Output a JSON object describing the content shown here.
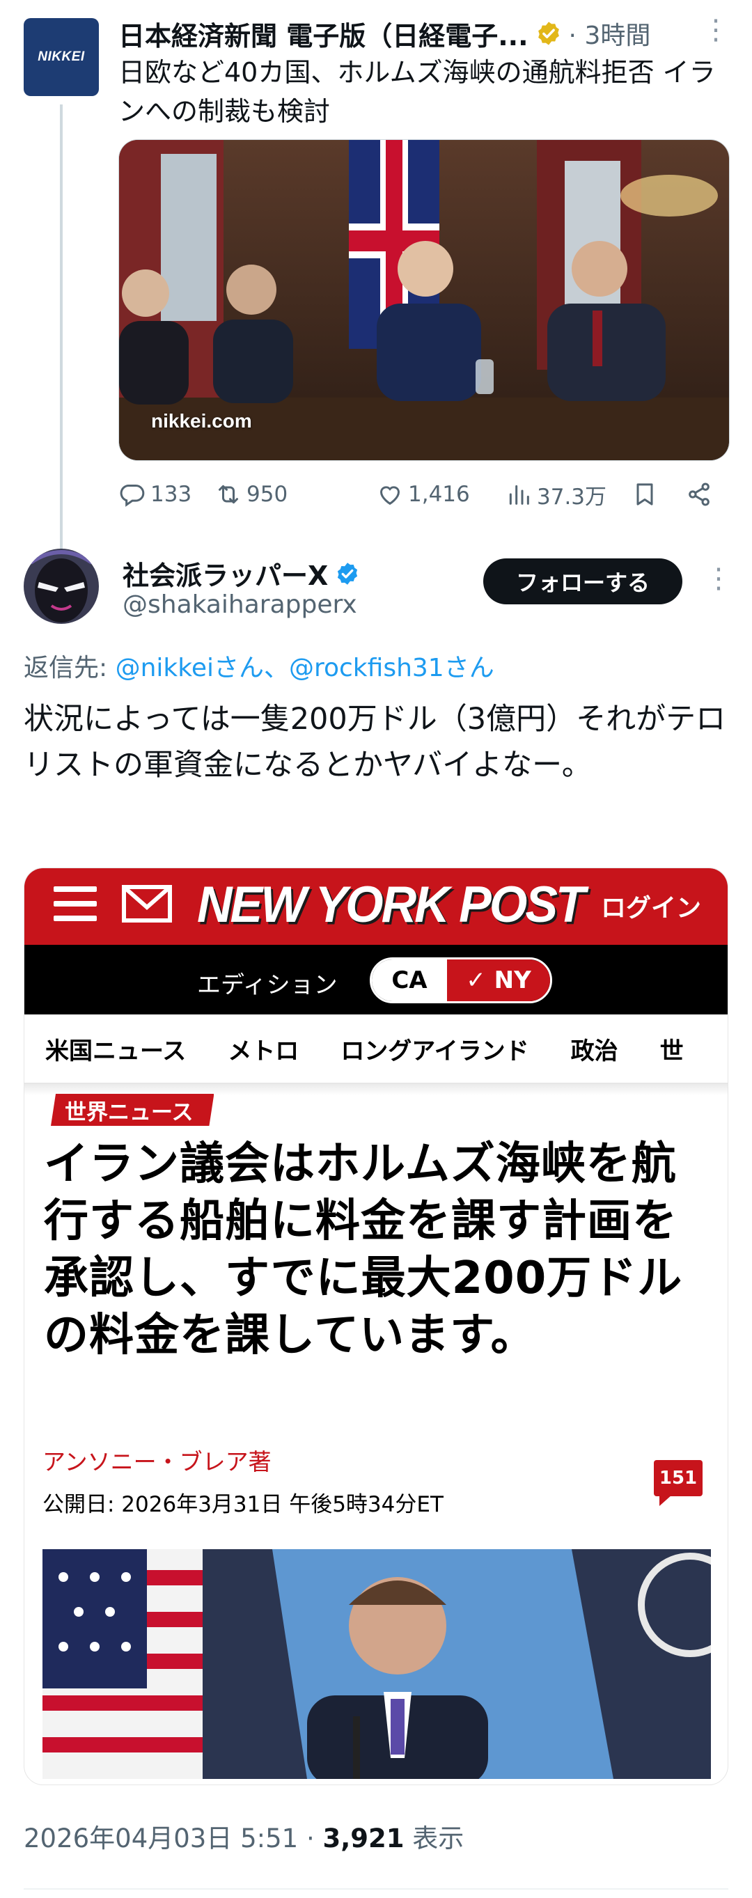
{
  "parent_tweet": {
    "avatar_text": "NIKKEI",
    "author_name": "日本経済新聞 電子版（日経電子...",
    "time": "3時間",
    "text": "日欧など40カ国、ホルムズ海峡の通航料拒否 イランへの制裁も検討",
    "image_caption": "nikkei.com",
    "replies": "133",
    "retweets": "950",
    "likes": "1,416",
    "views": "37.3万",
    "verified_badge_color": "#e2b719"
  },
  "reply_tweet": {
    "author_name": "社会派ラッパーX",
    "handle": "@shakaiharapperx",
    "follow_label": "フォローする",
    "reply_to_label": "返信先:",
    "reply_to_mentions": "@nikkeiさん、@rockfish31さん",
    "text": "状況によっては一隻200万ドル（3億円）それがテロリストの軍資金になるとかヤバイよなー。",
    "timestamp": "2026年04月03日 5:51",
    "separator": "·",
    "view_count": "3,921",
    "view_label": "表示",
    "verified_badge_color": "#1d9bf0"
  },
  "embed": {
    "logo": "NEW YORK POST",
    "login": "ログイン",
    "edition_label": "エディション",
    "edition_ca": "CA",
    "edition_ny": "✓ NY",
    "nav": [
      "米国ニュース",
      "メトロ",
      "ロングアイランド",
      "政治",
      "世"
    ],
    "section": "世界ニュース",
    "headline": "イラン議会はホルムズ海峡を航行する船舶に料金を課す計画を承認し、すでに最大200万ドルの料金を課しています。",
    "author": "アンソニー・ブレア著",
    "published": "公開日: 2026年3月31日 午後5時34分ET",
    "comment_count": "151",
    "brand_color": "#c7141b"
  }
}
